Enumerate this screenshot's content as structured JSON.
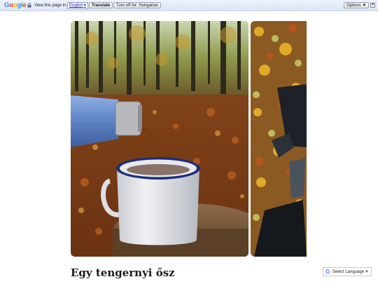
{
  "translate_bar": {
    "logo": "Google",
    "prompt": "View this page in:",
    "language": "English",
    "translate_label": "Translate",
    "turn_off_label": "Turn off for: Hungarian",
    "options_label": "Options ▼",
    "close_label": "✕"
  },
  "post": {
    "title": "Egy tengernyi ősz"
  },
  "language_selector": {
    "label": "Select Language",
    "arrow": "▼"
  },
  "colors": {
    "accent_blue": "#4285f4",
    "bar_bg": "#dde6f4"
  }
}
